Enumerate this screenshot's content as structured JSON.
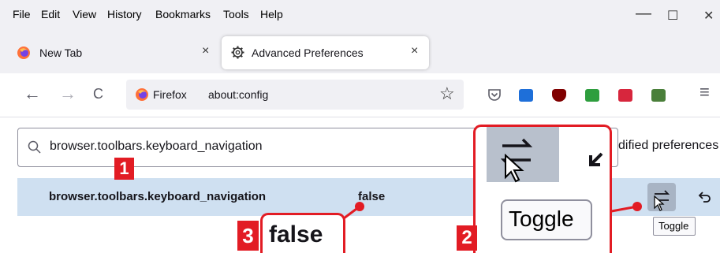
{
  "menu": [
    "File",
    "Edit",
    "View",
    "History",
    "Bookmarks",
    "Tools",
    "Help"
  ],
  "window_controls": {
    "minimize": "—",
    "maximize": "☐",
    "close": "✕"
  },
  "tabs": [
    {
      "label": "New Tab",
      "close": "×"
    },
    {
      "label": "Advanced Preferences",
      "close": "×"
    }
  ],
  "nav": {
    "back": "←",
    "forward": "→",
    "reload": "C",
    "identity": "Firefox",
    "url": "about:config",
    "bookmark_star": "☆",
    "menu": "≡"
  },
  "extensions": [
    {
      "icon": "pocket-icon",
      "color": "#5b5b66"
    },
    {
      "icon": "extension-blue-icon",
      "color": "#1e6fd9"
    },
    {
      "icon": "ublock-icon",
      "color": "#800000"
    },
    {
      "icon": "extension-green-icon",
      "color": "#2e9e3e"
    },
    {
      "icon": "camera-icon",
      "color": "#d7263d"
    },
    {
      "icon": "extension-profile-icon",
      "color": "#4a7f3a"
    }
  ],
  "search": {
    "value": "browser.toolbars.keyboard_navigation",
    "modified_label": "dified preferences"
  },
  "pref": {
    "name": "browser.toolbars.keyboard_navigation",
    "value": "false",
    "toggle_tooltip": "Toggle"
  },
  "annotations": {
    "label1": "1",
    "label2": "2",
    "label3": "3",
    "zoom_value": "false",
    "zoom_tooltip": "Toggle",
    "color": "#e21c24"
  }
}
